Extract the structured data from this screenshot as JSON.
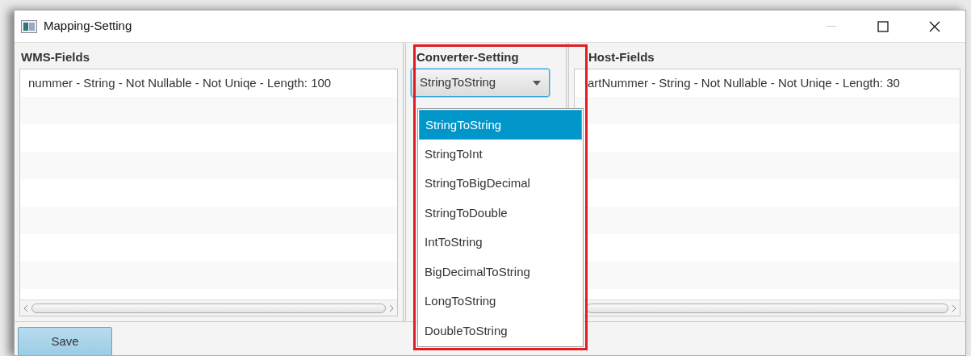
{
  "window": {
    "title": "Mapping-Setting",
    "minimize_disabled": true
  },
  "wms_fields": {
    "title": "WMS-Fields",
    "rows": [
      "nummer - String - Not Nullable - Not Uniqe - Length: 100"
    ]
  },
  "converter_setting": {
    "title": "Converter-Setting",
    "value": "StringToString",
    "expanded": true,
    "options": [
      {
        "label": "StringToString",
        "selected": true
      },
      {
        "label": "StringToInt",
        "selected": false
      },
      {
        "label": "StringToBigDecimal",
        "selected": false
      },
      {
        "label": "StringToDouble",
        "selected": false
      },
      {
        "label": "IntToString",
        "selected": false
      },
      {
        "label": "BigDecimalToString",
        "selected": false
      },
      {
        "label": "LongToString",
        "selected": false
      },
      {
        "label": "DoubleToString",
        "selected": false
      }
    ]
  },
  "host_fields": {
    "title": "Host-Fields",
    "rows": [
      "artNummer - String - Not Nullable - Not Uniqe - Length: 30"
    ]
  },
  "buttons": [
    "Save"
  ]
}
